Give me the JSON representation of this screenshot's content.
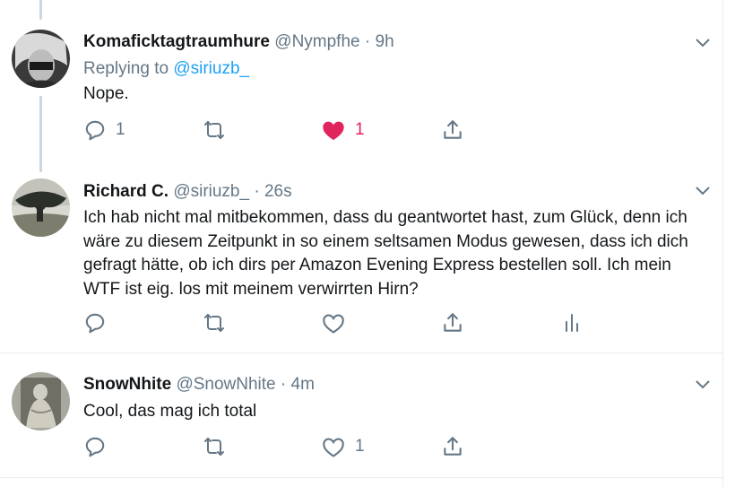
{
  "tweets": [
    {
      "name": "Komaficktagtraumhure",
      "handle": "@Nympfhe",
      "time": "9h",
      "replying_prefix": "Replying to",
      "replying_handle": "@siriuzb_",
      "text": "Nope.",
      "reply_count": "1",
      "like_count": "1",
      "liked": true,
      "avatar_icon": "avatar-person-with-mask"
    },
    {
      "name": "Richard C.",
      "handle": "@siriuzb_",
      "time": "26s",
      "text": "Ich hab nicht mal mitbekommen, dass du geantwortet hast, zum Glück, denn ich wäre zu diesem Zeitpunkt in so einem seltsamen Modus gewesen, dass ich dich gefragt hätte, ob ich dirs per Amazon Evening Express bestellen soll. Ich mein WTF ist eig. los mit meinem verwirrten Hirn?",
      "avatar_icon": "avatar-tree-landscape",
      "has_analytics": true
    },
    {
      "name": "SnowNhite",
      "handle": "@SnowNhite",
      "time": "4m",
      "text": "Cool, das mag ich total",
      "like_count": "1",
      "avatar_icon": "avatar-vintage-portrait"
    }
  ],
  "separator": "·",
  "colors": {
    "accent": "#1da1f2",
    "like": "#e0245e",
    "icon": "#657786",
    "border": "#e6ecf0",
    "thread_line": "#ccd6dd"
  }
}
